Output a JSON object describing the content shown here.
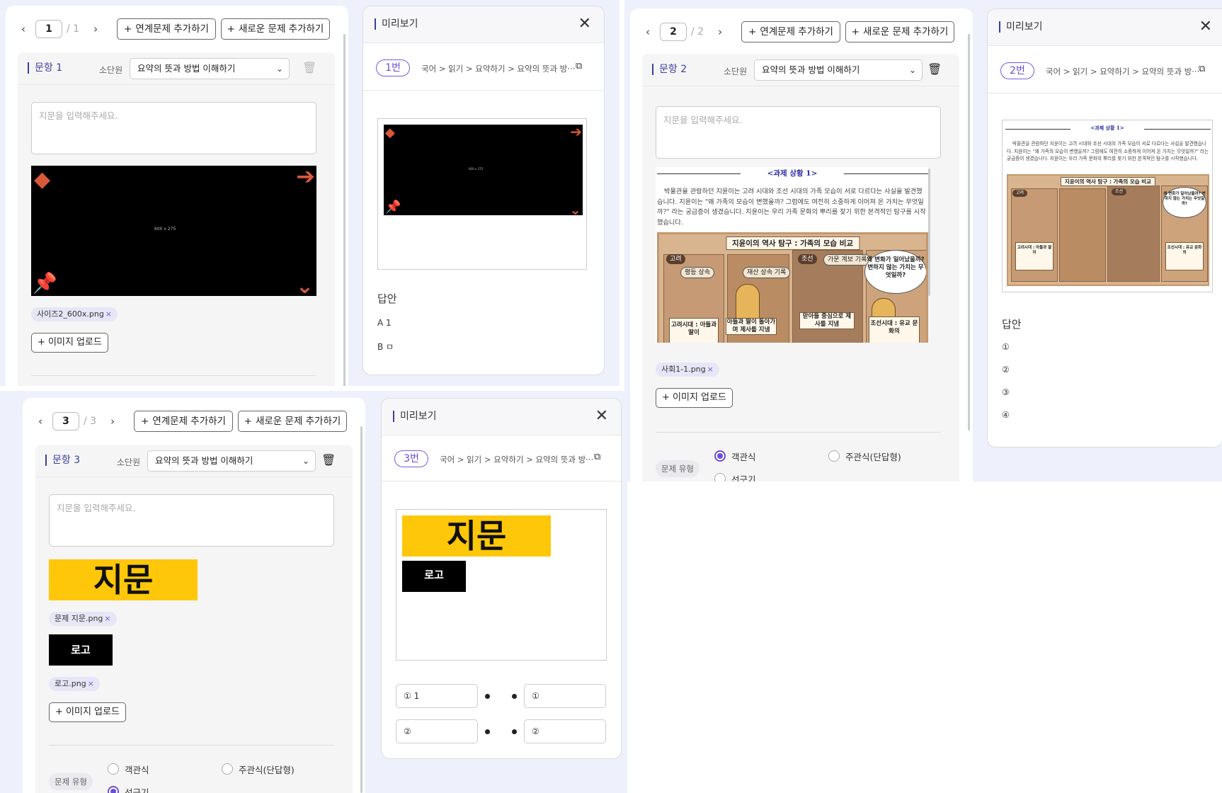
{
  "colors": {
    "accent": "#6a4ed6",
    "title": "#3c3f9c",
    "orange": "#d9583a",
    "yellow": "#fec709",
    "panel_bg": "#eef0fb"
  },
  "common": {
    "add_linked": "연계문제 추가하기",
    "add_new": "새로운 문제 추가하기",
    "subunit_label": "소단원",
    "subunit_value": "요약의 뜻과 방법 이해하기",
    "passage_placeholder": "지문을 입력해주세요.",
    "upload_label": "이미지 업로드",
    "preview_title": "미리보기",
    "answer_title": "답안",
    "qtype_label": "문제 유형",
    "opt_multiple": "객관식",
    "opt_short": "주관식(단답형)",
    "opt_match": "선긋기",
    "placeholder_image_size": "600 x 275"
  },
  "p1": {
    "page": "1",
    "total": "/ 1",
    "q_title": "문항 1",
    "chip": "사이즈2_600x.png",
    "badge": "1번",
    "crumb": "국어 > 읽기 > 요약하기 > 요약의 뜻과 방···",
    "answers": [
      "A 1",
      "B ㅁ"
    ]
  },
  "p2": {
    "page": "2",
    "total": "/ 2",
    "q_title": "문항 2",
    "chip": "사회1-1.png",
    "badge": "2번",
    "crumb": "국어 > 읽기 > 요약하기 > 요약의 뜻과 방···",
    "answers": [
      "①",
      "②",
      "③",
      "④"
    ],
    "doc": {
      "heading": "<과제 상황 1>",
      "body": "박물관을 관람하던 지윤이는 고려 시대와 조선 시대의 가족 모습이 서로 다르다는 사실을 발견했습니다. 지윤이는 \"왜 가족의 모습이 변했을까? 그럼에도 여전히 소중하게 이어져 온 가치는 무엇일까?\" 라는 궁금증이 생겼습니다. 지윤이는 우리 가족 문화의 뿌리를 찾기 위한 본격적인 탐구를 시작했습니다.",
      "comic_title": "지윤이의 역사 탐구 : 가족의 모습 비교",
      "tag_goryeo": "고려",
      "tag_joseon": "조선",
      "tag_inherit": "평등 상속",
      "tag_record": "재산 상속 기록",
      "tag_genealogy": "가문 계보 기록",
      "bubble": "왜 변화가 일어났을까? 변하지 않는 가치는 무엇일까?",
      "box_mid": "아들과 딸이 돌아가며 제사를 지냄",
      "box_eldest": "맏아들 중심으로 제사를 지냄",
      "box_goryeo": "고려시대 : 아들과 딸이",
      "box_joseon": "조선시대 : 유교 문화의"
    }
  },
  "p3": {
    "page": "3",
    "total": "/ 3",
    "q_title": "문항 3",
    "img_text": "지문",
    "chip1": "문제 지문.png",
    "logo_text": "로고",
    "chip2": "로고.png",
    "badge": "3번",
    "crumb": "국어 > 읽기 > 요약하기 > 요약의 뜻과 방···",
    "match_left": [
      "① 1",
      "②"
    ],
    "match_right": [
      "①",
      "②"
    ]
  }
}
